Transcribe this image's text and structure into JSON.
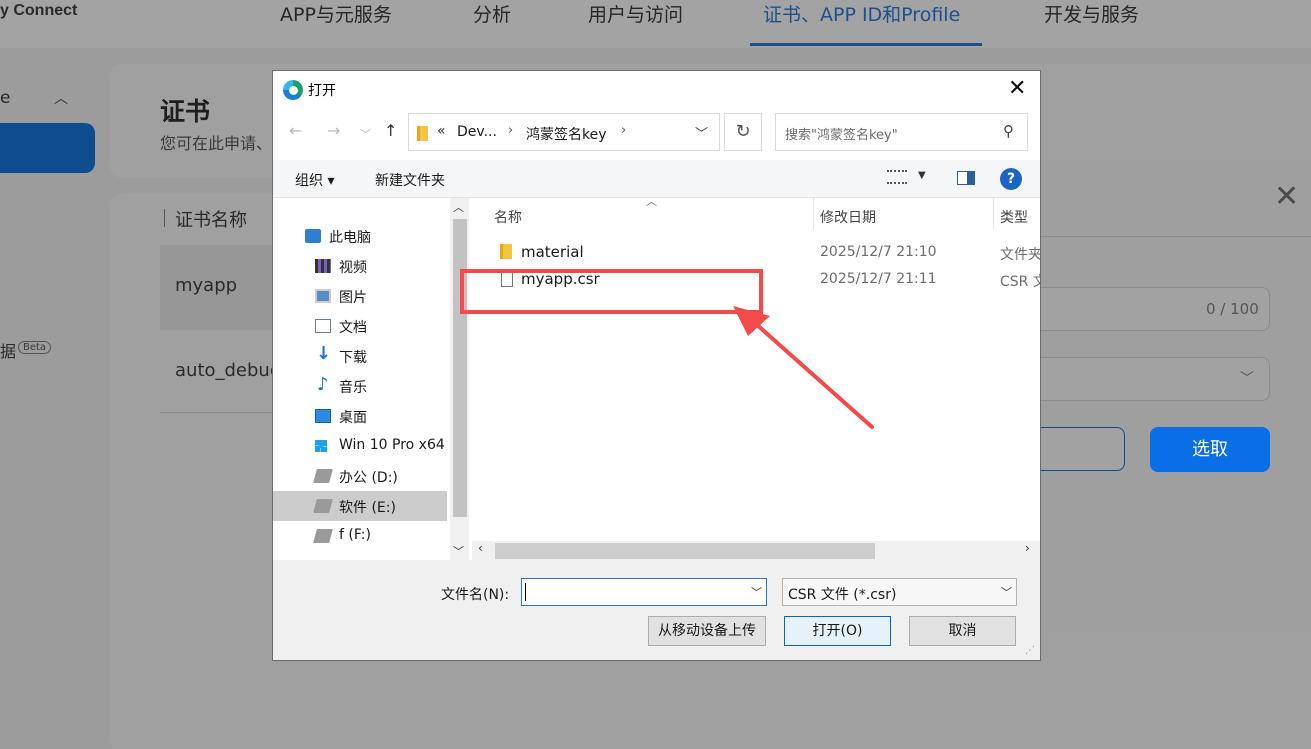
{
  "app": {
    "brand": "y Connect",
    "nav": [
      "APP与元服务",
      "分析",
      "用户与访问",
      "证书、APP ID和Profile",
      "开发与服务"
    ],
    "active_nav_index": 3,
    "sidebar": {
      "partial_label": "e",
      "data_label": "据",
      "beta_badge": "Beta"
    },
    "page_title": "证书",
    "page_subtitle": "您可在此申请、",
    "table": {
      "column": "证书名称",
      "rows": [
        "myapp",
        "auto_debug"
      ]
    },
    "modal": {
      "counter": "0 / 100",
      "pick_button": "选取"
    }
  },
  "dialog": {
    "title": "打开",
    "breadcrumb": {
      "overflow": "«",
      "crumbs": [
        "Dev...",
        "鸿蒙签名key"
      ]
    },
    "search_placeholder": "搜索\"鸿蒙签名key\"",
    "toolbar": {
      "organize": "组织 ▾",
      "new_folder": "新建文件夹",
      "help": "?"
    },
    "tree": [
      {
        "label": "此电脑",
        "icon": "pc-icon",
        "root": true
      },
      {
        "label": "视频",
        "icon": "video-icon"
      },
      {
        "label": "图片",
        "icon": "pictures-icon"
      },
      {
        "label": "文档",
        "icon": "documents-icon"
      },
      {
        "label": "下载",
        "icon": "downloads-icon"
      },
      {
        "label": "音乐",
        "icon": "music-icon"
      },
      {
        "label": "桌面",
        "icon": "desktop-icon"
      },
      {
        "label": "Win 10 Pro x64",
        "icon": "windows-drive-icon"
      },
      {
        "label": "办公 (D:)",
        "icon": "drive-icon"
      },
      {
        "label": "软件 (E:)",
        "icon": "drive-icon",
        "selected": true
      },
      {
        "label": "f (F:)",
        "icon": "drive-icon"
      }
    ],
    "columns": {
      "name": "名称",
      "date": "修改日期",
      "type": "类型"
    },
    "files": [
      {
        "name": "material",
        "date": "2025/12/7 21:10",
        "type": "文件夹",
        "icon": "folder-icon"
      },
      {
        "name": "myapp.csr",
        "date": "2025/12/7 21:11",
        "type": "CSR 文件",
        "icon": "file-icon"
      }
    ],
    "footer": {
      "filename_label": "文件名(N):",
      "filename_value": "",
      "filetype": "CSR 文件 (*.csr)",
      "upload_button": "从移动设备上传",
      "open_button": "打开(O)",
      "cancel_button": "取消"
    }
  },
  "annotation_color": "#f24b4b"
}
